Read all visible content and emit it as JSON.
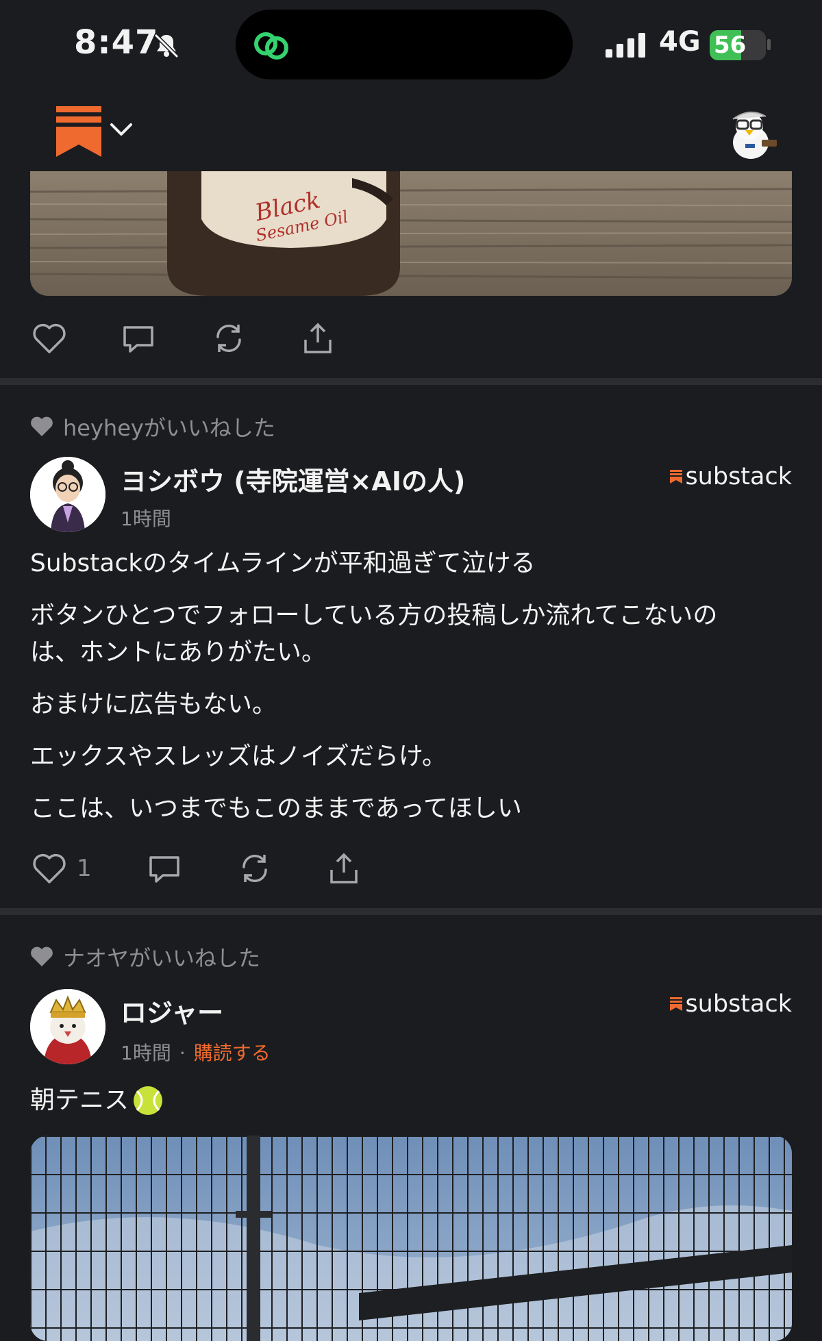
{
  "status_bar": {
    "time": "8:47",
    "network": "4G",
    "battery": "56",
    "battery_level": 0.56
  },
  "feed": {
    "post1": {
      "like_icon": "heart-icon",
      "comment_icon": "comment-icon",
      "restack_icon": "restack-icon",
      "share_icon": "share-icon"
    },
    "post2": {
      "liked_by": "heyheyがいいねした",
      "author": "ヨシボウ (寺院運営×AIの人)",
      "time": "1時間",
      "source": "substack",
      "paragraphs": [
        "Substackのタイムラインが平和過ぎて泣ける",
        "ボタンひとつでフォローしている方の投稿しか流れてこないの",
        "は、ホントにありがたい。",
        "おまけに広告もない。",
        "エックスやスレッズはノイズだらけ。",
        "ここは、いつまでもこのままであってほしい"
      ],
      "like_count": "1"
    },
    "post3": {
      "liked_by": "ナオヤがいいねした",
      "author": "ロジャー",
      "time": "1時間",
      "dot": "·",
      "subscribe": "購読する",
      "source": "substack",
      "text": "朝テニス",
      "emoji": "tennis-ball"
    }
  },
  "colors": {
    "background": "#1b1c1f",
    "accent": "#ef6a2f",
    "muted": "#8e8e93",
    "battery": "#3fbf56"
  }
}
